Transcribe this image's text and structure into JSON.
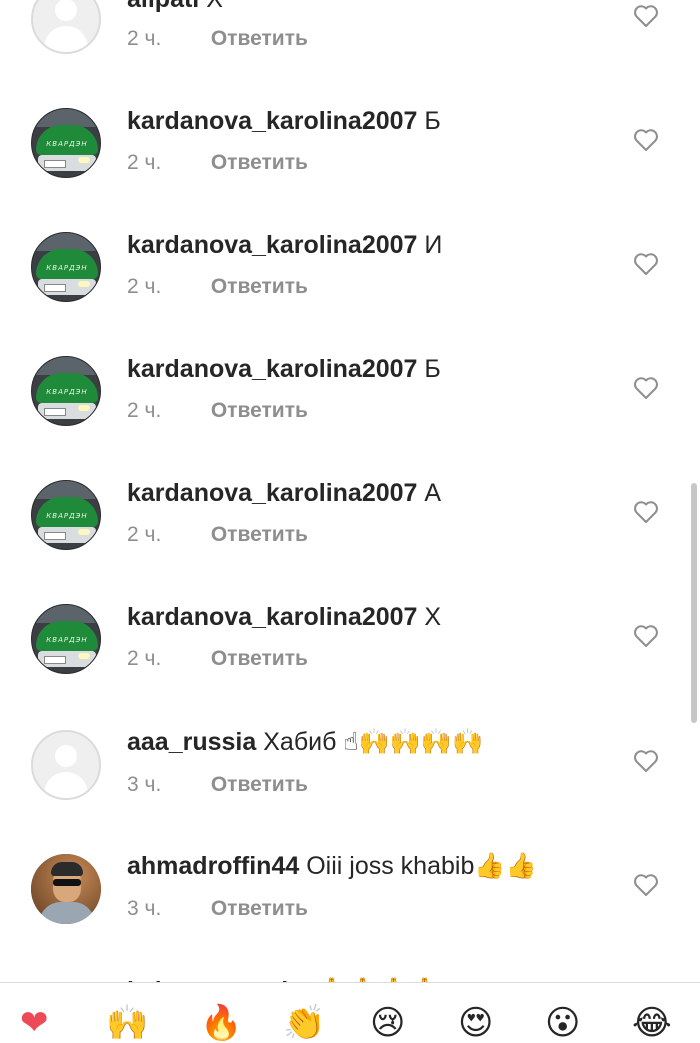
{
  "comments": [
    {
      "username": "alipati",
      "text": "Х",
      "time": "2 ч.",
      "reply": "Ответить",
      "avatar": "default-avatar"
    },
    {
      "username": "kardanova_karolina2007",
      "text": "Б",
      "time": "2 ч.",
      "reply": "Ответить",
      "avatar": "car-avatar"
    },
    {
      "username": "kardanova_karolina2007",
      "text": "И",
      "time": "2 ч.",
      "reply": "Ответить",
      "avatar": "car-avatar"
    },
    {
      "username": "kardanova_karolina2007",
      "text": "Б",
      "time": "2 ч.",
      "reply": "Ответить",
      "avatar": "car-avatar"
    },
    {
      "username": "kardanova_karolina2007",
      "text": "А",
      "time": "2 ч.",
      "reply": "Ответить",
      "avatar": "car-avatar"
    },
    {
      "username": "kardanova_karolina2007",
      "text": "Х",
      "time": "2 ч.",
      "reply": "Ответить",
      "avatar": "car-avatar"
    },
    {
      "username": "aaa_russia",
      "text": "Хабиб ☝🙌🙌🙌🙌",
      "time": "3 ч.",
      "reply": "Ответить",
      "avatar": "default-avatar"
    },
    {
      "username": "ahmadroffin44",
      "text": "Oiii joss khabib👍👍",
      "time": "3 ч.",
      "reply": "Ответить",
      "avatar": "person-avatar"
    }
  ],
  "partial_comment": {
    "username": "j...i...e...a...t...i...",
    "text": "🙏🙏🙏🙏"
  },
  "car_avatar_text": "КВАРДЭН",
  "quick_emojis": [
    "❤",
    "🙌",
    "🔥",
    "👏",
    "😢",
    "😍",
    "😮",
    "😂"
  ],
  "colors": {
    "text": "#262626",
    "secondary": "#8e8e8e",
    "heart": "#8e8e8e",
    "like_red": "#ed4956"
  }
}
